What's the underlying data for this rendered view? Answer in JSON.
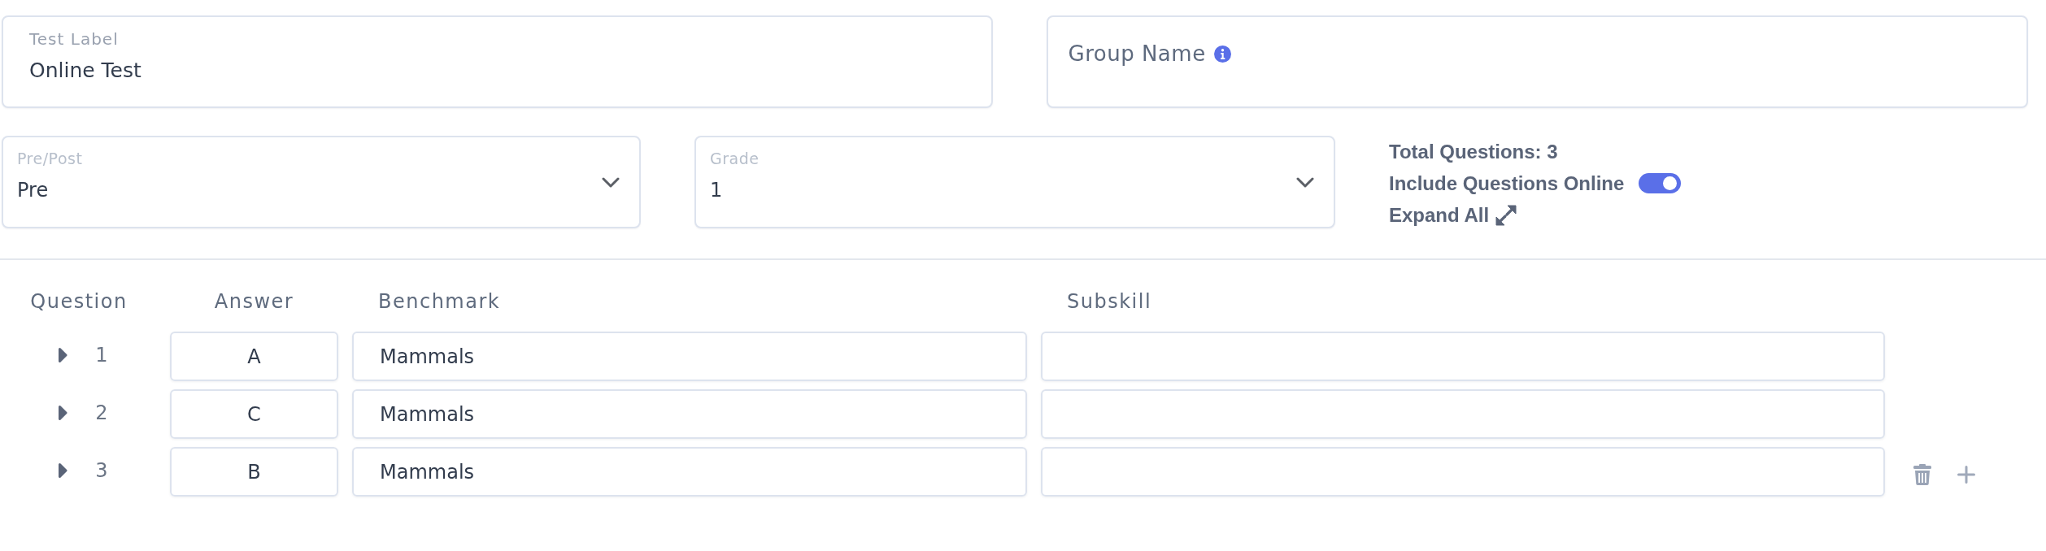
{
  "test_label": {
    "label": "Test Label",
    "value": "Online Test"
  },
  "group_name": {
    "label": "Group Name"
  },
  "pre_post": {
    "label": "Pre/Post",
    "value": "Pre"
  },
  "grade": {
    "label": "Grade",
    "value": "1"
  },
  "summary": {
    "total_questions": "Total Questions: 3",
    "include_online": {
      "label": "Include Questions Online",
      "on": true
    },
    "expand_all": "Expand All"
  },
  "table": {
    "columns": [
      "Question",
      "Answer",
      "Benchmark",
      "Subskill"
    ],
    "rows": [
      {
        "number": "1",
        "expanded": false,
        "answer": "A",
        "benchmark": "Mammals",
        "show_actions": false
      },
      {
        "number": "2",
        "expanded": false,
        "answer": "C",
        "benchmark": "Mammals",
        "show_actions": false
      },
      {
        "number": "3",
        "expanded": false,
        "answer": "B",
        "benchmark": "Mammals",
        "show_actions": true
      }
    ]
  }
}
